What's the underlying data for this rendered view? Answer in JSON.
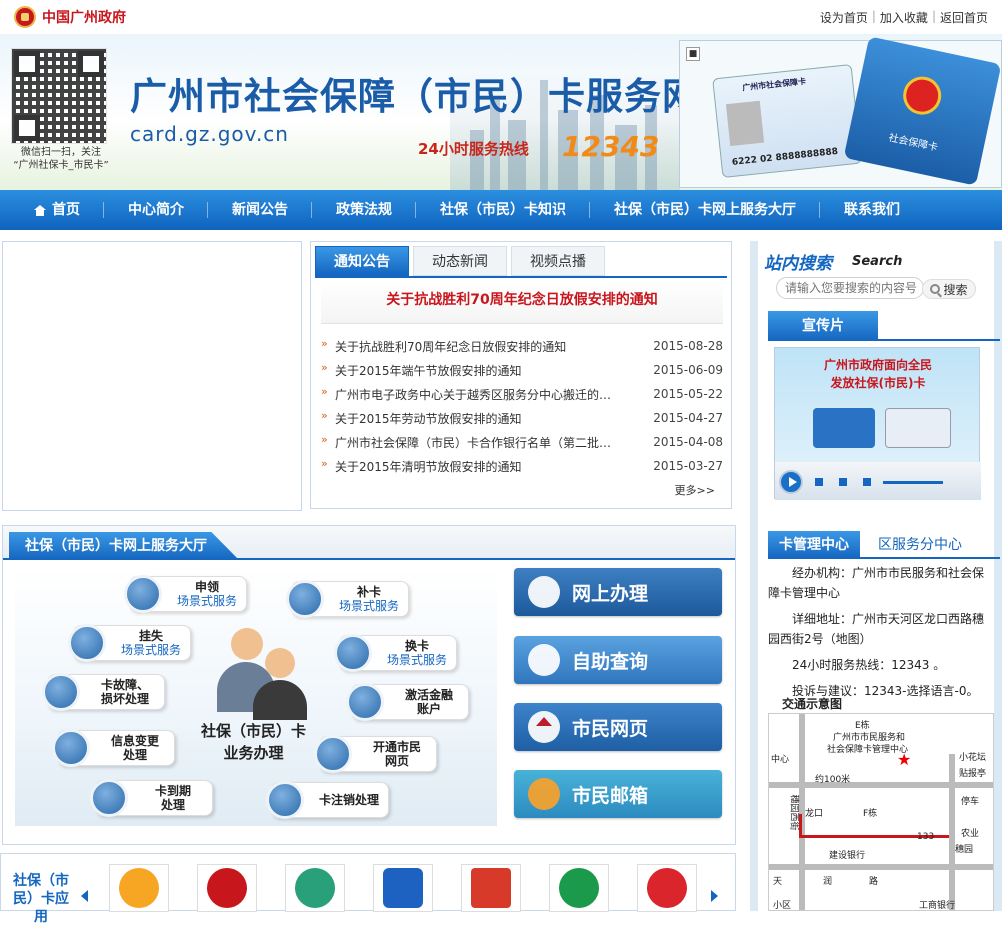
{
  "header": {
    "gov_name": "中国广州政府",
    "links": [
      "设为首页",
      "加入收藏",
      "返回首页"
    ]
  },
  "banner": {
    "qr_caption_1": "微信扫一扫，关注",
    "qr_caption_2": "“广州社保卡_市民卡”",
    "title": "广州市社会保障（市民）卡服务网",
    "url": "card.gz.gov.cn",
    "hotline_label": "24小时服务热线",
    "hotline_number": "12343",
    "card_number": "6222 02 8888888888",
    "card_header": "广州市社会保障卡",
    "card2_text": "社会保障卡"
  },
  "nav": {
    "items": [
      "首页",
      "中心简介",
      "新闻公告",
      "政策法规",
      "社保（市民）卡知识",
      "社保（市民）卡网上服务大厅",
      "联系我们"
    ]
  },
  "news": {
    "tabs": [
      "通知公告",
      "动态新闻",
      "视频点播"
    ],
    "headline": "关于抗战胜利70周年纪念日放假安排的通知",
    "items": [
      {
        "title": "关于抗战胜利70周年纪念日放假安排的通知",
        "date": "2015-08-28"
      },
      {
        "title": "关于2015年端午节放假安排的通知",
        "date": "2015-06-09"
      },
      {
        "title": "广州市电子政务中心关于越秀区服务分中心搬迁的通...",
        "date": "2015-05-22"
      },
      {
        "title": "关于2015年劳动节放假安排的通知",
        "date": "2015-04-27"
      },
      {
        "title": "广州市社会保障（市民）卡合作银行名单（第二批）...",
        "date": "2015-04-08"
      },
      {
        "title": "关于2015年清明节放假安排的通知",
        "date": "2015-03-27"
      }
    ],
    "more": "更多>>"
  },
  "search": {
    "title": "站内搜索",
    "title_en": "Search",
    "placeholder": "请输入您要搜索的内容号",
    "button": "搜索"
  },
  "promo": {
    "tab": "宣传片",
    "text_1": "广州市政府面向全民",
    "text_2": "发放社保(市民)卡"
  },
  "center": {
    "tab_active": "卡管理中心",
    "tab_other": "区服务分中心",
    "org": "经办机构：广州市市民服务和社会保障卡管理中心",
    "address": "详细地址：广州市天河区龙口西路穗园西街2号（地图）",
    "hotline": "24小时服务热线：12343 。",
    "complaint": "投诉与建议：12343-选择语言-0。",
    "map_title": "交通示意图",
    "map_labels": [
      "E栋",
      "广州市市民服务和",
      "社会保障卡管理中心",
      "中心",
      "小花坛",
      "贴报亭",
      "约100米",
      "停车",
      "农业",
      "F栋",
      "建设银行",
      "133",
      "天",
      "润",
      "路",
      "小区",
      "工商银行",
      "穗园西街",
      "穗园",
      "龙口"
    ]
  },
  "hall": {
    "tab": "社保（市民）卡网上服务大厅",
    "services": [
      {
        "label": "申领",
        "sub": "场景式服务"
      },
      {
        "label": "补卡",
        "sub": "场景式服务"
      },
      {
        "label": "挂失",
        "sub": "场景式服务"
      },
      {
        "label": "换卡",
        "sub": "场景式服务"
      },
      {
        "label": "卡故障、",
        "sub": "损坏处理"
      },
      {
        "label": "激活金融",
        "sub": "账户"
      },
      {
        "label": "信息变更",
        "sub": "处理"
      },
      {
        "label": "开通市民",
        "sub": "网页"
      },
      {
        "label": "卡到期",
        "sub": "处理"
      },
      {
        "label": "卡注销处理",
        "sub": ""
      }
    ],
    "core_1": "社保（市民）卡",
    "core_2": "业务办理",
    "big_buttons": [
      "网上办理",
      "自助查询",
      "市民网页",
      "市民邮箱"
    ]
  },
  "links": {
    "label": "社保（市民）卡应用"
  },
  "colors": {
    "brand_blue": "#1466c0",
    "brand_red": "#c8161d",
    "hotline_orange": "#f18a16"
  }
}
